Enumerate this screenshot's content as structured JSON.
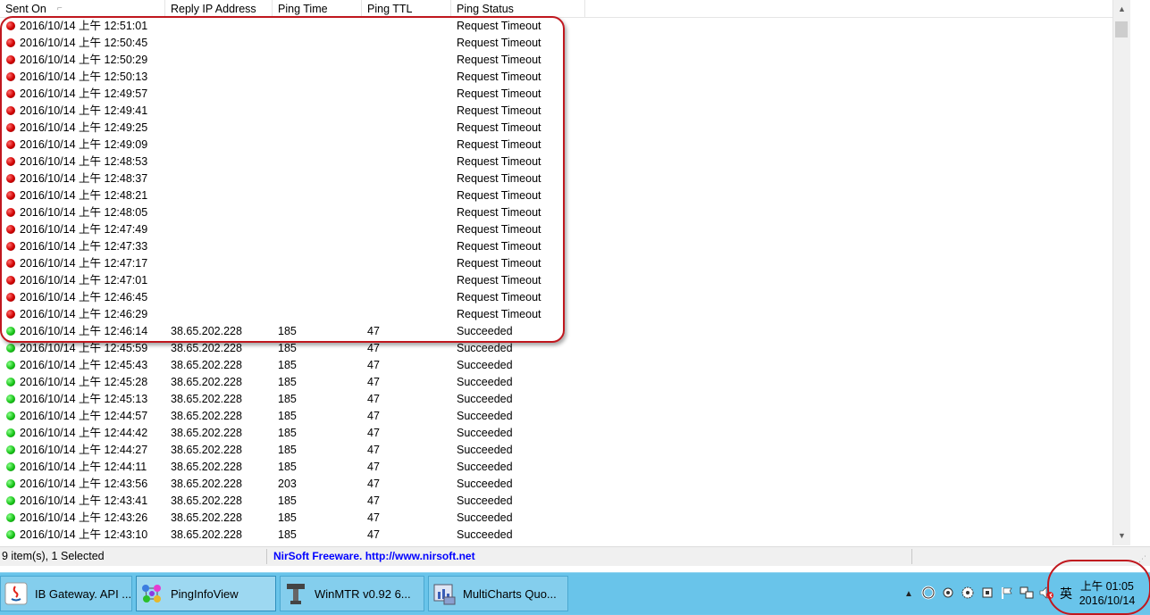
{
  "columns": [
    "Sent On",
    "Reply IP Address",
    "Ping Time",
    "Ping TTL",
    "Ping Status"
  ],
  "rows": [
    {
      "status": "fail",
      "sent_on": "2016/10/14 上午 12:51:01",
      "ip": "",
      "time": "",
      "ttl": "",
      "result": "Request Timeout"
    },
    {
      "status": "fail",
      "sent_on": "2016/10/14 上午 12:50:45",
      "ip": "",
      "time": "",
      "ttl": "",
      "result": "Request Timeout"
    },
    {
      "status": "fail",
      "sent_on": "2016/10/14 上午 12:50:29",
      "ip": "",
      "time": "",
      "ttl": "",
      "result": "Request Timeout"
    },
    {
      "status": "fail",
      "sent_on": "2016/10/14 上午 12:50:13",
      "ip": "",
      "time": "",
      "ttl": "",
      "result": "Request Timeout"
    },
    {
      "status": "fail",
      "sent_on": "2016/10/14 上午 12:49:57",
      "ip": "",
      "time": "",
      "ttl": "",
      "result": "Request Timeout"
    },
    {
      "status": "fail",
      "sent_on": "2016/10/14 上午 12:49:41",
      "ip": "",
      "time": "",
      "ttl": "",
      "result": "Request Timeout"
    },
    {
      "status": "fail",
      "sent_on": "2016/10/14 上午 12:49:25",
      "ip": "",
      "time": "",
      "ttl": "",
      "result": "Request Timeout"
    },
    {
      "status": "fail",
      "sent_on": "2016/10/14 上午 12:49:09",
      "ip": "",
      "time": "",
      "ttl": "",
      "result": "Request Timeout"
    },
    {
      "status": "fail",
      "sent_on": "2016/10/14 上午 12:48:53",
      "ip": "",
      "time": "",
      "ttl": "",
      "result": "Request Timeout"
    },
    {
      "status": "fail",
      "sent_on": "2016/10/14 上午 12:48:37",
      "ip": "",
      "time": "",
      "ttl": "",
      "result": "Request Timeout"
    },
    {
      "status": "fail",
      "sent_on": "2016/10/14 上午 12:48:21",
      "ip": "",
      "time": "",
      "ttl": "",
      "result": "Request Timeout"
    },
    {
      "status": "fail",
      "sent_on": "2016/10/14 上午 12:48:05",
      "ip": "",
      "time": "",
      "ttl": "",
      "result": "Request Timeout"
    },
    {
      "status": "fail",
      "sent_on": "2016/10/14 上午 12:47:49",
      "ip": "",
      "time": "",
      "ttl": "",
      "result": "Request Timeout"
    },
    {
      "status": "fail",
      "sent_on": "2016/10/14 上午 12:47:33",
      "ip": "",
      "time": "",
      "ttl": "",
      "result": "Request Timeout"
    },
    {
      "status": "fail",
      "sent_on": "2016/10/14 上午 12:47:17",
      "ip": "",
      "time": "",
      "ttl": "",
      "result": "Request Timeout"
    },
    {
      "status": "fail",
      "sent_on": "2016/10/14 上午 12:47:01",
      "ip": "",
      "time": "",
      "ttl": "",
      "result": "Request Timeout"
    },
    {
      "status": "fail",
      "sent_on": "2016/10/14 上午 12:46:45",
      "ip": "",
      "time": "",
      "ttl": "",
      "result": "Request Timeout"
    },
    {
      "status": "fail",
      "sent_on": "2016/10/14 上午 12:46:29",
      "ip": "",
      "time": "",
      "ttl": "",
      "result": "Request Timeout"
    },
    {
      "status": "ok",
      "sent_on": "2016/10/14 上午 12:46:14",
      "ip": "38.65.202.228",
      "time": "185",
      "ttl": "47",
      "result": "Succeeded"
    },
    {
      "status": "ok",
      "sent_on": "2016/10/14 上午 12:45:59",
      "ip": "38.65.202.228",
      "time": "185",
      "ttl": "47",
      "result": "Succeeded"
    },
    {
      "status": "ok",
      "sent_on": "2016/10/14 上午 12:45:43",
      "ip": "38.65.202.228",
      "time": "185",
      "ttl": "47",
      "result": "Succeeded"
    },
    {
      "status": "ok",
      "sent_on": "2016/10/14 上午 12:45:28",
      "ip": "38.65.202.228",
      "time": "185",
      "ttl": "47",
      "result": "Succeeded"
    },
    {
      "status": "ok",
      "sent_on": "2016/10/14 上午 12:45:13",
      "ip": "38.65.202.228",
      "time": "185",
      "ttl": "47",
      "result": "Succeeded"
    },
    {
      "status": "ok",
      "sent_on": "2016/10/14 上午 12:44:57",
      "ip": "38.65.202.228",
      "time": "185",
      "ttl": "47",
      "result": "Succeeded"
    },
    {
      "status": "ok",
      "sent_on": "2016/10/14 上午 12:44:42",
      "ip": "38.65.202.228",
      "time": "185",
      "ttl": "47",
      "result": "Succeeded"
    },
    {
      "status": "ok",
      "sent_on": "2016/10/14 上午 12:44:27",
      "ip": "38.65.202.228",
      "time": "185",
      "ttl": "47",
      "result": "Succeeded"
    },
    {
      "status": "ok",
      "sent_on": "2016/10/14 上午 12:44:11",
      "ip": "38.65.202.228",
      "time": "185",
      "ttl": "47",
      "result": "Succeeded"
    },
    {
      "status": "ok",
      "sent_on": "2016/10/14 上午 12:43:56",
      "ip": "38.65.202.228",
      "time": "203",
      "ttl": "47",
      "result": "Succeeded"
    },
    {
      "status": "ok",
      "sent_on": "2016/10/14 上午 12:43:41",
      "ip": "38.65.202.228",
      "time": "185",
      "ttl": "47",
      "result": "Succeeded"
    },
    {
      "status": "ok",
      "sent_on": "2016/10/14 上午 12:43:26",
      "ip": "38.65.202.228",
      "time": "185",
      "ttl": "47",
      "result": "Succeeded"
    },
    {
      "status": "ok",
      "sent_on": "2016/10/14 上午 12:43:10",
      "ip": "38.65.202.228",
      "time": "185",
      "ttl": "47",
      "result": "Succeeded"
    }
  ],
  "statusbar": {
    "count": "9 item(s), 1 Selected",
    "link": "NirSoft Freeware.  http://www.nirsoft.net"
  },
  "taskbar": {
    "buttons": [
      {
        "label": "IB Gateway.  API ...",
        "icon": "java-icon"
      },
      {
        "label": "PingInfoView",
        "icon": "network-icon",
        "active": true
      },
      {
        "label": "WinMTR v0.92 6...",
        "icon": "winmtr-icon"
      },
      {
        "label": "MultiCharts Quo...",
        "icon": "multicharts-icon"
      }
    ],
    "ime": "英",
    "clock_time": "上午 01:05",
    "clock_date": "2016/10/14"
  },
  "colors": {
    "fail": "#d00000",
    "ok": "#17c417",
    "annotation": "#c0171e",
    "taskbar": "#69c4ea"
  }
}
